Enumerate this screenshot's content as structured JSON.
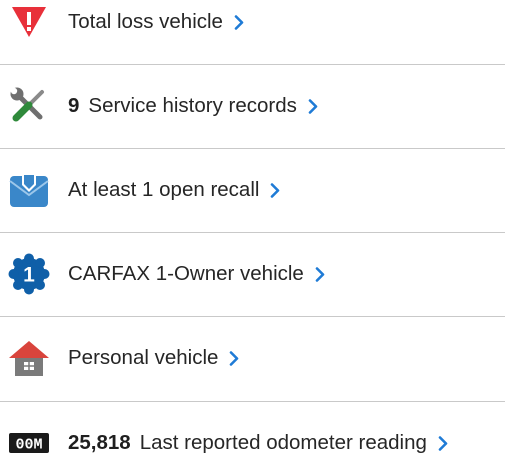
{
  "colors": {
    "alert_red": "#e8303a",
    "recall_blue": "#3a87c9",
    "owner_blue": "#0f5fa8",
    "tools_green": "#2f8a3b",
    "house_roof": "#d9443c",
    "house_body": "#7a7a7a",
    "link_blue": "#1f7bd6",
    "divider": "#c9c9c9"
  },
  "items": [
    {
      "icon": "warning-triangle-icon",
      "count": "",
      "label": "Total loss vehicle"
    },
    {
      "icon": "wrench-screwdriver-icon",
      "count": "9",
      "label": "Service history records"
    },
    {
      "icon": "recall-envelope-icon",
      "count": "",
      "label": "At least 1 open recall"
    },
    {
      "icon": "one-owner-badge-icon",
      "count": "",
      "label": "CARFAX 1-Owner vehicle",
      "badge_text": "1"
    },
    {
      "icon": "house-icon",
      "count": "",
      "label": "Personal vehicle"
    },
    {
      "icon": "odometer-icon",
      "count": "25,818",
      "label": "Last reported odometer reading",
      "badge_text": "00M"
    }
  ]
}
